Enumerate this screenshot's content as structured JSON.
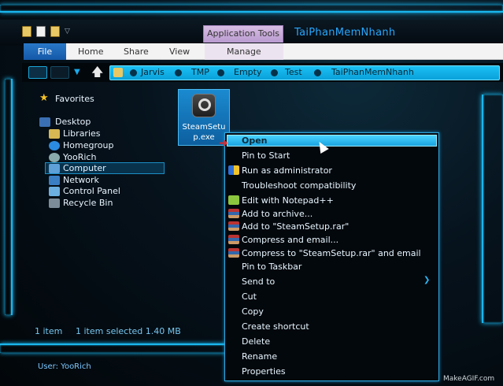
{
  "window": {
    "title": "TaiPhanMemNhanh"
  },
  "ribbon": {
    "context_tab": "Application Tools",
    "tabs": [
      "File",
      "Home",
      "Share",
      "View",
      "Manage"
    ]
  },
  "address": {
    "crumbs": [
      "Jarvis",
      "TMP",
      "Empty",
      "Test",
      "TaiPhanMemNhanh"
    ]
  },
  "nav": {
    "favorites": "Favorites",
    "items": [
      "Desktop",
      "Libraries",
      "Homegroup",
      "YooRich",
      "Computer",
      "Network",
      "Control Panel",
      "Recycle Bin"
    ]
  },
  "file": {
    "name_line1": "SteamSetu",
    "name_line2": "p.exe"
  },
  "status": {
    "count": "1 item",
    "selection": "1 item selected  1.40 MB"
  },
  "user": "User: YooRich",
  "watermark": "MakeAGIF.com",
  "context_menu": {
    "items": [
      "Open",
      "Pin to Start",
      "Run as administrator",
      "Troubleshoot compatibility",
      "Edit with Notepad++",
      "Add to archive...",
      "Add to \"SteamSetup.rar\"",
      "Compress and email...",
      "Compress to \"SteamSetup.rar\" and email",
      "Pin to Taskbar",
      "Send to",
      "Cut",
      "Copy",
      "Create shortcut",
      "Delete",
      "Rename",
      "Properties"
    ]
  },
  "colors": {
    "accent": "#1ab6ee",
    "address_bg": "#15b3ec",
    "context_tab": "#c8acd9",
    "file_tab": "#1e66b8"
  }
}
